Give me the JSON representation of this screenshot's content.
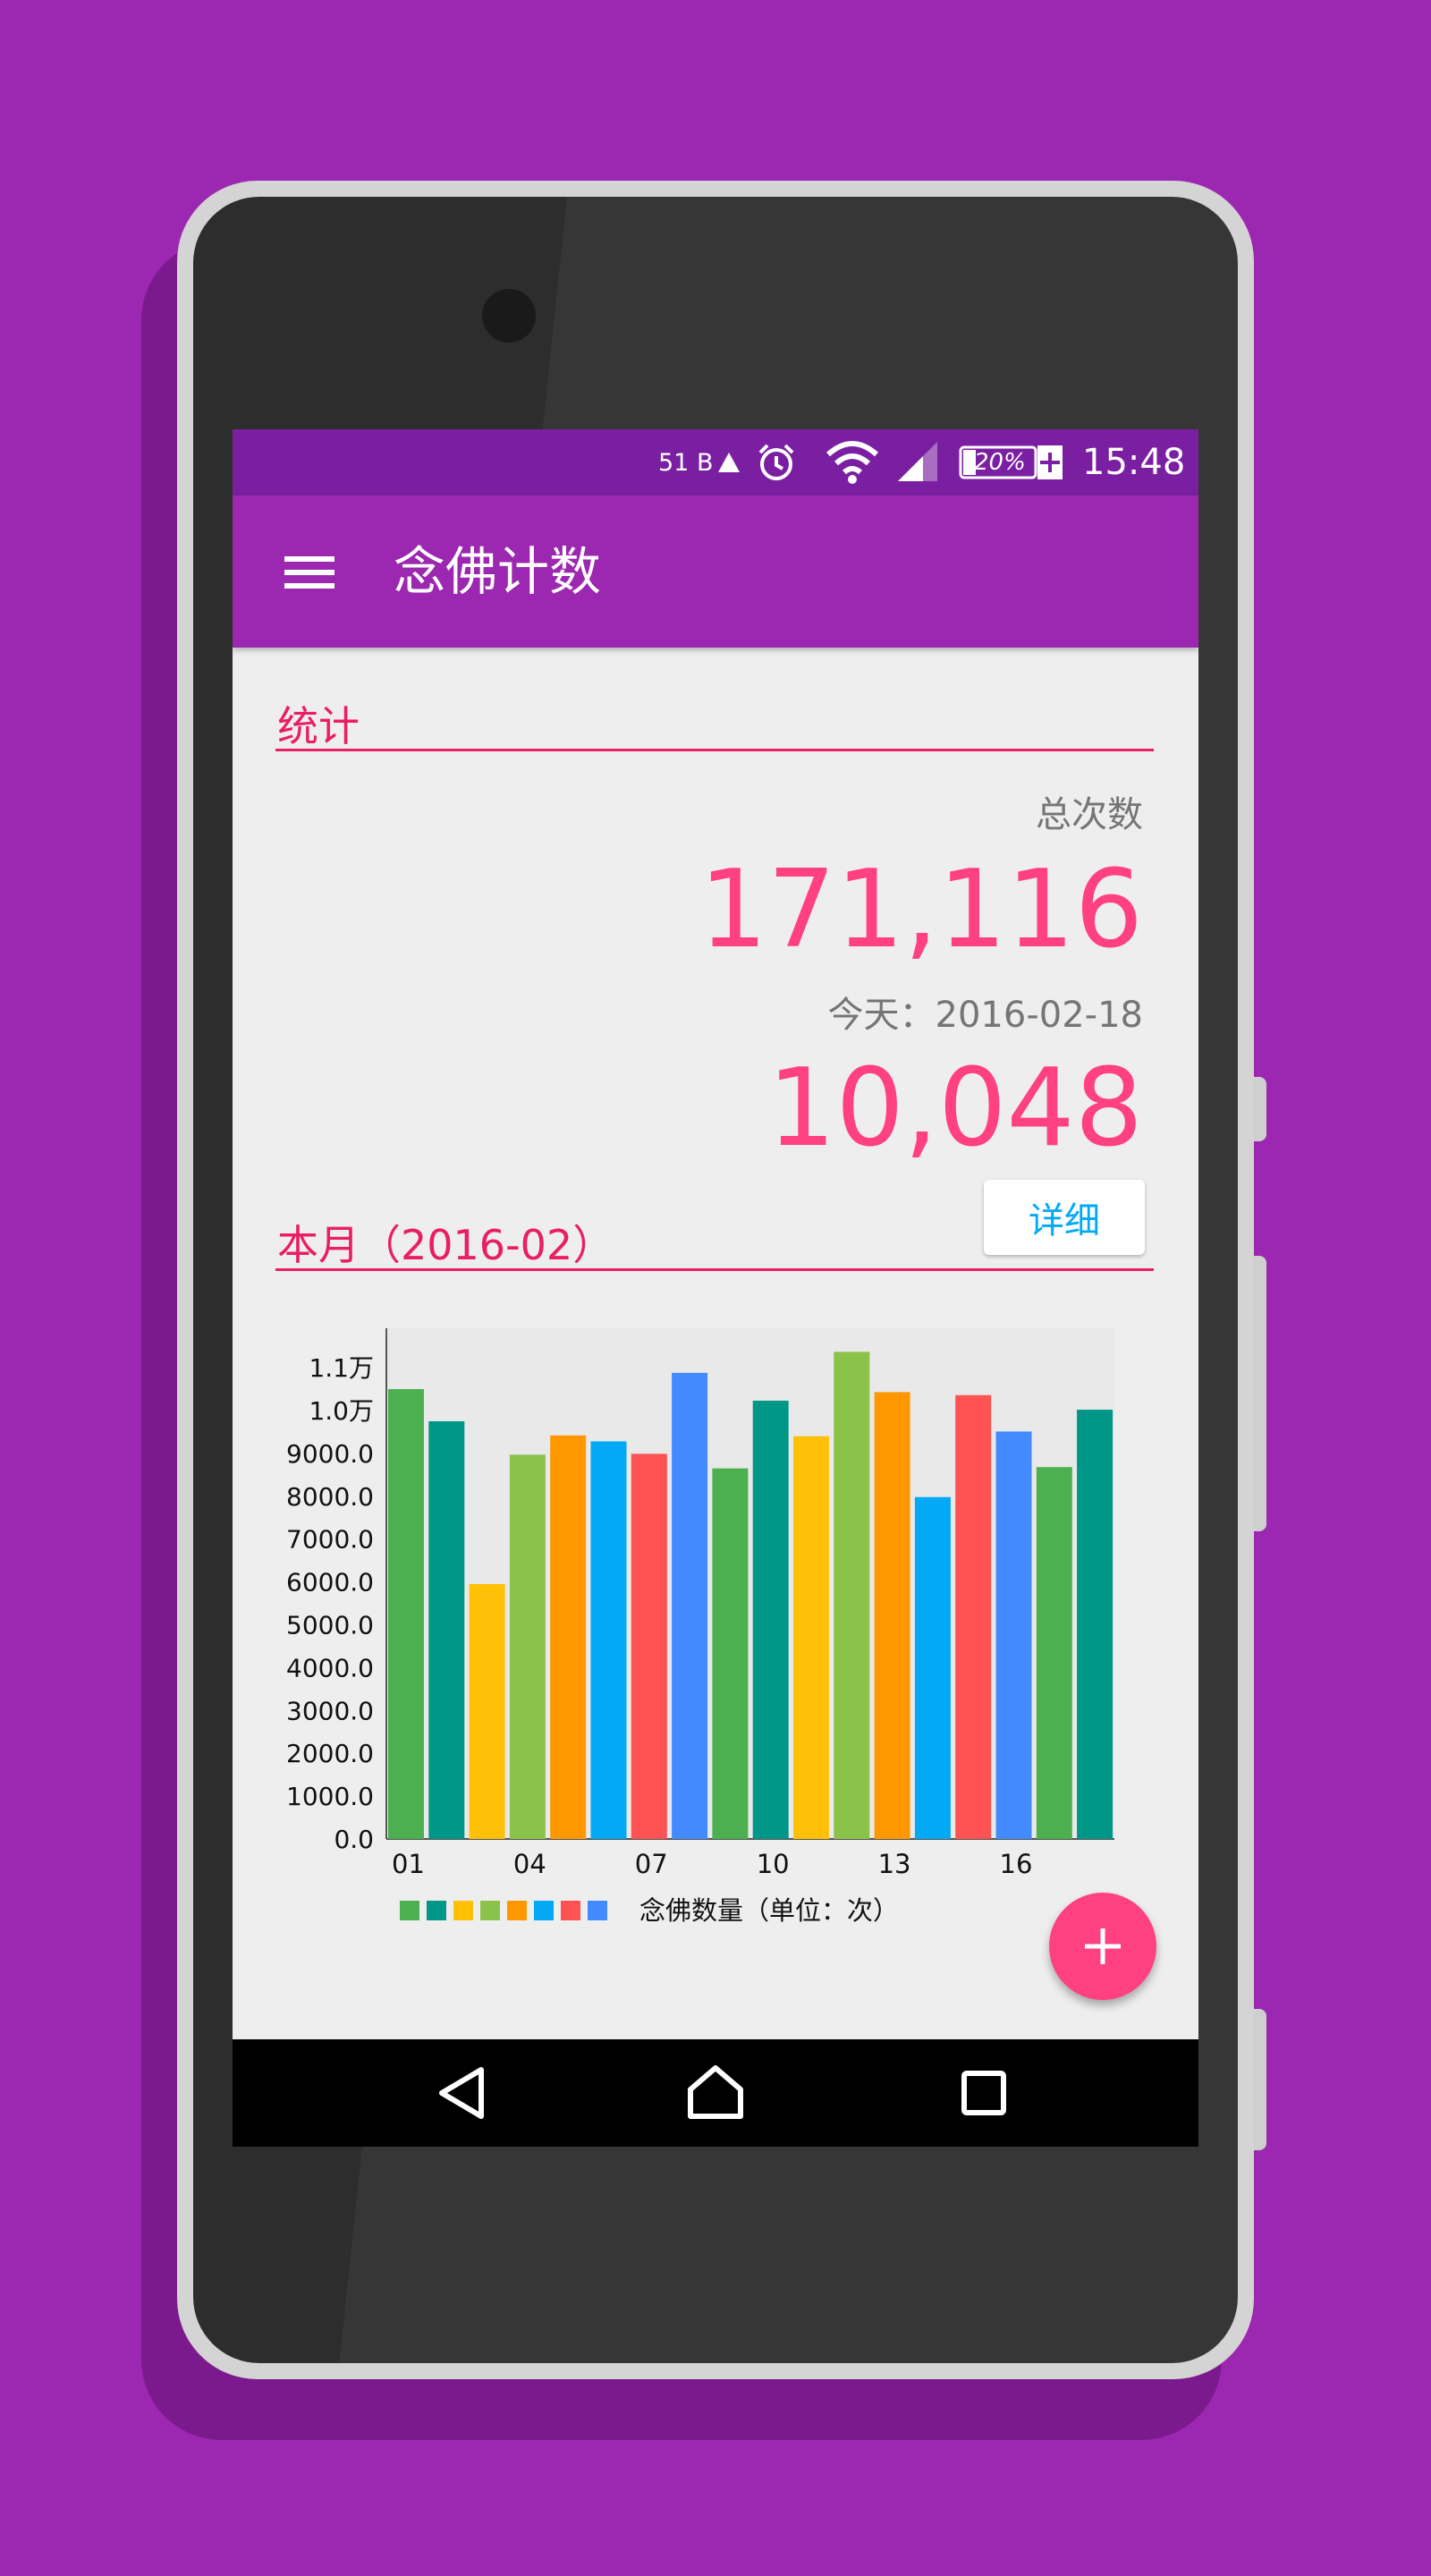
{
  "statusbar": {
    "data_rate": "51 B",
    "battery": "20%",
    "time": "15:48",
    "icons": [
      "data-arrow-icon",
      "alarm-icon",
      "wifi-icon",
      "cell-signal-icon",
      "battery-icon"
    ]
  },
  "toolbar": {
    "title": "念佛计数",
    "menu_icon": "menu-icon"
  },
  "stats": {
    "section_title": "统计",
    "total_label": "总次数",
    "total_value": "171,116",
    "today_label": "今天：2016-02-18",
    "today_value": "10,048",
    "detail_button": "详细"
  },
  "month": {
    "section_title": "本月（2016-02）"
  },
  "chart_data": {
    "type": "bar",
    "categories": [
      "01",
      "02",
      "03",
      "04",
      "05",
      "06",
      "07",
      "08",
      "09",
      "10",
      "11",
      "12",
      "13",
      "14",
      "15",
      "16",
      "17",
      "18"
    ],
    "x_tick_labels": [
      "01",
      "04",
      "07",
      "10",
      "13",
      "16"
    ],
    "values": [
      10500,
      9750,
      5950,
      8970,
      9420,
      9280,
      8990,
      10880,
      8650,
      10230,
      9400,
      11370,
      10430,
      7980,
      10360,
      9510,
      8680,
      10020
    ],
    "colors": [
      "#4caf50",
      "#009688",
      "#ffc107",
      "#8bc34a",
      "#ff9800",
      "#03a9f4",
      "#ff5252",
      "#448aff",
      "#4caf50",
      "#009688",
      "#ffc107",
      "#8bc34a",
      "#ff9800",
      "#03a9f4",
      "#ff5252",
      "#448aff",
      "#4caf50",
      "#009688"
    ],
    "y_tick_labels": [
      "0.0",
      "1000.0",
      "2000.0",
      "3000.0",
      "4000.0",
      "5000.0",
      "6000.0",
      "7000.0",
      "8000.0",
      "9000.0",
      "1.0万",
      "1.1万"
    ],
    "ylim": [
      0,
      12000
    ],
    "legend_label": "念佛数量（单位：次）",
    "legend_colors": [
      "#4caf50",
      "#009688",
      "#ffc107",
      "#8bc34a",
      "#ff9800",
      "#03a9f4",
      "#ff5252",
      "#448aff"
    ],
    "grid": false
  },
  "fab": {
    "icon": "plus-icon"
  },
  "navbar": {
    "icons": [
      "back-icon",
      "home-icon",
      "recents-icon"
    ]
  }
}
